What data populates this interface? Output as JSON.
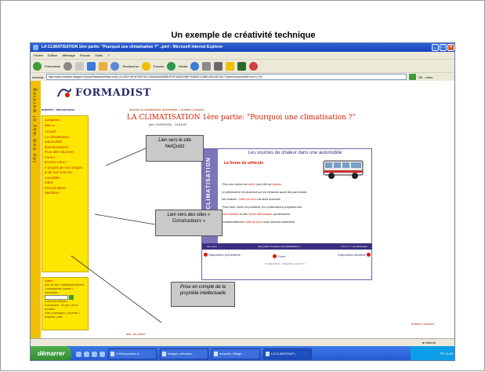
{
  "slide": {
    "title": "Un exemple de créativité technique"
  },
  "window": {
    "title": "LA CLIMATISATION 1ère partie: \"Pourquoi une climatisation ?\" ..perf - Microsoft Internet Explorer",
    "menu": [
      "Fichier",
      "Edition",
      "Affichage",
      "Favoris",
      "Outils",
      "?"
    ],
    "toolbar": {
      "back": "Précédente",
      "search": "Rechercher",
      "favorites": "Favoris",
      "media": "Média"
    },
    "address_label": "Adresse",
    "address": "http://www.nouvelle-villages.fr/QuickPlace/perf/Main.nsf/h_E100CF19F4FDEF92C1256E4600059E4F/0F3A3BC98FF44655C1256E4E00467367/?OpenDocument&Form=h_Pa",
    "go": "OK",
    "links": "Liens"
  },
  "site": {
    "strip": "the new way of working",
    "logo": "FORMADIST",
    "user": "autoferf : déconnecter",
    "breadcrumb": "accueil: la climatisation automobile > dossier | suivant",
    "page_title": "LA CLIMATISATION 1ère partie: \"Pourquoi une climatisation ?\"",
    "page_date": "perf, 04/03/2004 - 14:46:02",
    "nav_head1": "Actualités",
    "nav_head2": "Aller à",
    "nav_items": [
      "Accueil",
      "La climatisation",
      "automobile",
      "Questionnaires",
      "Pour aller plus loin",
      "Forum",
      "Écrivez-nous !",
      "A propos de nos images",
      "& de nos sources ...",
      "Actualités",
      "Index",
      "Personnaliser",
      "Membres"
    ],
    "tools_head": "Outils",
    "tools_text1": "plan de site | statistiques thèmes | sauvegardes dossier | historiques",
    "tools_text2": "recherche étendue",
    "tools_text3": "nouveautés : du jour | de la semaine",
    "tools_text4": "chat | notification | imprimer | détacher | aide",
    "foot_left": "aller au début",
    "foot_right": "dossier | suivant"
  },
  "doc": {
    "side": "LA CLIMATISATION",
    "header": "Les sources de chaleur dans une automobile",
    "sub": "La forme du véhicule",
    "text1a": "Plus une voiture est ",
    "text1b": "vitrée",
    "text1c": ", plus elle est ",
    "text1d": "chaude",
    "text2": "Le phénomène est accentué sur les véhicules ayant des pare-brises",
    "text3a": "très inclinés : ",
    "text3b": "l'effet de serre",
    "text3c": " est alors accentué.",
    "text4": "Pour lutter contre ce problème, les constructeurs proposent des",
    "text5a": "vitres teintées",
    "text5b": " et des ",
    "text5c": "verres athermiques",
    "text5d": " qui diminuent",
    "text6a": "considérablement ",
    "text6b": "l'effet de serre",
    "text6c": " sans l'annuler totalement.",
    "footer_left": "tenu-nom",
    "footer_mid": "1ère partie: Pourquoi une climatisation ?",
    "footer_right": "A 5 m / 7 / Les Echos/ser",
    "prev": "Diapositive précédente",
    "zoom": "Zoom",
    "next": "Diapositive suivante",
    "info": "14 diapositives - Diapositive numéro 5"
  },
  "callouts": {
    "c1": "Lien vers le site NetQuizz",
    "c2": "Lien vers des sites « Constructeurs »",
    "c3": "Prise en compte de la propriété intellectuelle"
  },
  "status": {
    "zone": "Internet"
  },
  "taskbar": {
    "start": "démarrer",
    "items": [
      "C:\\Documents a...",
      "images_mémoire...",
      "nouvelle-Village -...",
      "LA CLIMATISATI..."
    ],
    "tray": "FR  11:43"
  }
}
